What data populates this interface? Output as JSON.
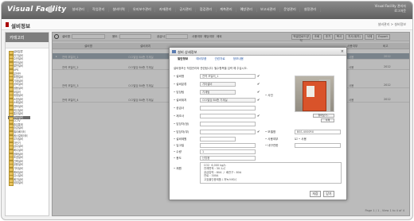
{
  "app": {
    "title": "Visual Facility",
    "user_line1": "Visual Facility 관리자",
    "user_line2": "로그아웃"
  },
  "nav": [
    "설비관리",
    "작업관리",
    "설비이력",
    "유지보수관리",
    "자재관리",
    "공사관리",
    "점검관리",
    "계측관리",
    "예방관리",
    "보고서관리",
    "운영관리",
    "설정관리"
  ],
  "page": {
    "title": "설비정보",
    "breadcrumb": "설비관리 > 설비정보"
  },
  "sidebar": {
    "title": "카테고리",
    "items": [
      "설비분류",
      "전기설비",
      "수전설비",
      "변전설비",
      "발전설비",
      "UPS",
      "분전반",
      "조명설비",
      "기계설비",
      "공조설비",
      "냉동설비",
      "보일러",
      "위생설비",
      "소방설비",
      "소화설비",
      "경보설비",
      "피난설비",
      "통신설비",
      "방송설비",
      "CCTV",
      "출입통제",
      "승강설비",
      "엘리베이터",
      "에스컬레이터",
      "주차설비",
      "차단기",
      "급수설비",
      "배수설비",
      "정화설비",
      "조경설비",
      "건축설비",
      "공용설비",
      "기타설비",
      "예비설비",
      "임시설비",
      "폐기설비",
      "외부설비"
    ],
    "selected_index": 18
  },
  "toolbar": {
    "labels": [
      "설비명",
      "용도",
      "공급사",
      "사용여부",
      "해당여부"
    ],
    "checkbox_text": "제외",
    "buttons": [
      "엑셀업로드양식",
      "조회",
      "추가",
      "복사",
      "지사(위치)",
      "삭제",
      "Export"
    ]
  },
  "grid": {
    "columns": [
      "설비명",
      "설비위치",
      "설비분류",
      "용도",
      "사용여부",
      "비고"
    ],
    "rows": [
      {
        "name": "전력 모일러_1",
        "loc": "ㅁㅁ빌딩 B4층 기계실",
        "cat": "기타설비",
        "use": "사용",
        "etc": "2012"
      },
      {
        "name": "전력 모일러_2",
        "loc": "ㅁㅁ빌딩 B4층 기계실",
        "cat": "기타설비",
        "use": "사용",
        "etc": "2012"
      },
      {
        "name": "전력 모일러_3",
        "loc": "ㅁㅁ빌딩 B4층 기계실",
        "cat": "기타설비",
        "use": "사용",
        "etc": "2012"
      },
      {
        "name": "전력 모일러_4",
        "loc": "ㅁㅁ빌딩 B4층 기계실",
        "cat": "기타설비",
        "use": "사용",
        "etc": "2012"
      }
    ],
    "pager": "Page 1 / 1 , View 1 to 4 of 4"
  },
  "modal": {
    "title": "설비 상세정보",
    "close": "×",
    "tabs": [
      "일반정보",
      "예비부품",
      "관련자료",
      "정보내용"
    ],
    "notice": "설비정보는 작업관리와 관련됩니다. 필수항목을 입력 해 주십시오.",
    "fields": {
      "name_label": "설비명",
      "name_value": "전력 모일러_1",
      "category_label": "설비분류",
      "category_value": "기타설비",
      "manager_label": "담당팀",
      "manager_value": "기계팀",
      "location_label": "설비위치",
      "location_value": "ㅁㅁ빌딩 B4층 기계실",
      "supplier_label": "공급사",
      "supplier_value": "",
      "maker_label": "제조사",
      "maker_value": "",
      "person1_label": "담당자(정)",
      "person1_value": "",
      "person2_label": "담당자(부)",
      "person2_value": "",
      "model_label": "모델명",
      "model_value": "BSS-4000RX",
      "spec_label": "설비제원",
      "spec_value": "",
      "use_label": "사용여부",
      "use_value": "사용",
      "install_label": "입고일",
      "install_value": "",
      "qty_label": "수량",
      "qty_value": "1",
      "price_label": "내구연한",
      "price_value": "",
      "usage_label": "용도",
      "usage_value": "난방용",
      "note_label": "제원"
    },
    "photo_label": "사진",
    "photo_buttons": [
      "찾아보기...",
      "삭제"
    ],
    "memo": "CO2  6,000 kg/h\n전체면적 : 30.1㎡\n공급압력 : 80A  /  배관구 : 80A\n연료 : 300A\n고효율인증제품 / 저녹스버너",
    "buttons": [
      "저장",
      "닫기"
    ]
  }
}
